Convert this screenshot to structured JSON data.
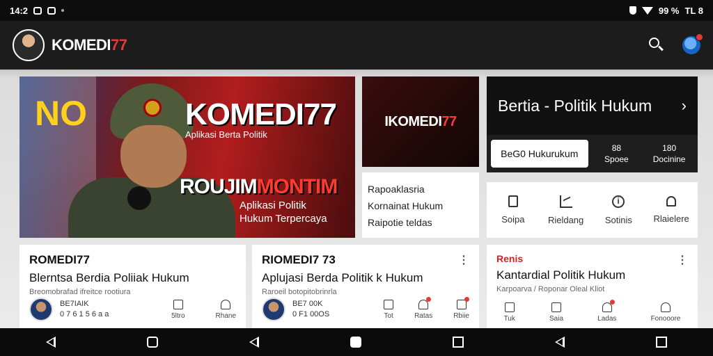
{
  "status_bar": {
    "time": "14:2",
    "battery": "99 %",
    "clock_right": "TL 8"
  },
  "app_bar": {
    "brand_main": "KOMEDI",
    "brand_accent": "77"
  },
  "hero": {
    "no_text": "NO",
    "title": "KOMEDI77",
    "subtitle": "Aplikasi Berta Politik",
    "headline_white": "ROUJIM",
    "headline_red": "MONTIM",
    "tagline_line1": "Aplikasi Politik",
    "tagline_line2": "Hukum Terpercaya"
  },
  "promo": {
    "brand_main": "IKOMEDI",
    "brand_accent": "77",
    "lines": [
      "Rapoaklasria",
      "Kornainat Hukum",
      "Raipotie teldas"
    ]
  },
  "category": {
    "title": "Bertia - Politik Hukum",
    "chevron": "›",
    "filter_label": "BeG0 Hukurukum",
    "stat1_value": "88",
    "stat1_label": "Spoee",
    "stat2_value": "180",
    "stat2_label": "Docinine"
  },
  "actions": [
    {
      "label": "Soipa",
      "icon": "bookmark-icon"
    },
    {
      "label": "Rieldang",
      "icon": "chart-icon"
    },
    {
      "label": "Sotinis",
      "icon": "info-icon"
    },
    {
      "label": "Rlaielere",
      "icon": "bell-icon"
    }
  ],
  "cards": [
    {
      "source": "ROMEDI77",
      "headline": "Blerntsa Berdia Poliiak Hukum",
      "meta": "Breomobrafad ifreitce rootiura",
      "author_line1": "BE7IAIK",
      "author_line2": "0 7 6 1 5 6 a a",
      "acts": [
        "5ltro",
        "Rhane"
      ]
    },
    {
      "source": "RIOMEDI7 73",
      "more": "⋮",
      "headline": "Aplujasi Berda Politik k Hukum",
      "meta": "Raroeil botopitobrinrla",
      "author_line1": "BE7 00K",
      "author_line2": "0 F1 00OS",
      "acts": [
        "Tot",
        "Ratas",
        "Rbiie"
      ]
    },
    {
      "source": "Renis",
      "more": "⋮",
      "headline": "Kantardial Politik Hukum",
      "meta": "Karpoarva / Roponar Oleal Kliot",
      "acts": [
        "Tuk",
        "Saia",
        "Ladas",
        "Fonooore"
      ]
    }
  ],
  "colors": {
    "accent_red": "#e53935",
    "hero_yellow": "#ffd11a"
  }
}
